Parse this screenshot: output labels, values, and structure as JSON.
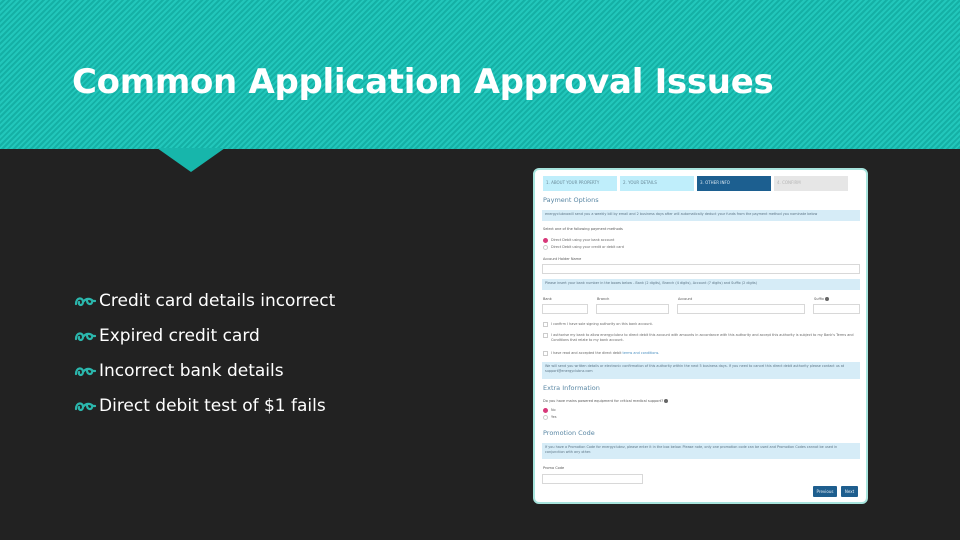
{
  "slide": {
    "title": "Common Application Approval Issues",
    "bullet_icon": "scroll-fleuron-icon",
    "bullets": [
      "Credit card details incorrect",
      "Expired credit card",
      "Incorrect bank details",
      "Direct debit test of $1 fails"
    ],
    "colors": {
      "accent": "#1cbfb3",
      "background": "#222222",
      "text": "#ffffff"
    }
  },
  "form": {
    "steps": [
      {
        "label": "1. About your property"
      },
      {
        "label": "2. Your details"
      },
      {
        "label": "3. Other info"
      },
      {
        "label": "4. Confirm"
      }
    ],
    "payment": {
      "title": "Payment Options",
      "info": "energyclubnowill send you a weekly bill by email and 2 business days after will automatically deduct your funds from the payment method you nominate below",
      "select_label": "Select one of the following payment methods",
      "options": [
        "Direct Debit using your bank account",
        "Direct Debit using your credit or debit card"
      ],
      "account_holder_label": "Account Holder Name",
      "bank_info": "Please insert your bank number in the boxes below - Bank (2 digits), Branch (4 digits), Account (7 digits) and Suffix (2 digits)",
      "bank_label": "Bank",
      "branch_label": "Branch",
      "account_label": "Account",
      "suffix_label": "Suffix",
      "confirm_1": "I confirm I have sole signing authority on this bank account.",
      "confirm_2": "I authorise my bank to allow energyclubnz to direct debit this account with amounts in accordance with this authority and accept this authority is subject to my Bank's Terms and Conditions that relate to my bank account.",
      "confirm_3_prefix": "I have read and accepted the direct debit",
      "confirm_3_link": "terms and conditions.",
      "notice": "We will send you written details or electronic confirmation of this authority within the next 5 business days. If you need to cancel this direct debit authority please contact us at support@energyclubnz.com"
    },
    "extra": {
      "title": "Extra Information",
      "question": "Do you have mains powered equipment for critical medical support?",
      "options": [
        "No",
        "Yes"
      ]
    },
    "promo": {
      "title": "Promotion Code",
      "info": "If you have a Promotion Code for energyclubnz, please enter it in the box below. Please note, only one promotion code can be used and Promotion Codes cannot be used in conjunction with any other.",
      "code_label": "Promo Code"
    },
    "buttons": {
      "previous": "Previous",
      "next": "Next"
    }
  }
}
